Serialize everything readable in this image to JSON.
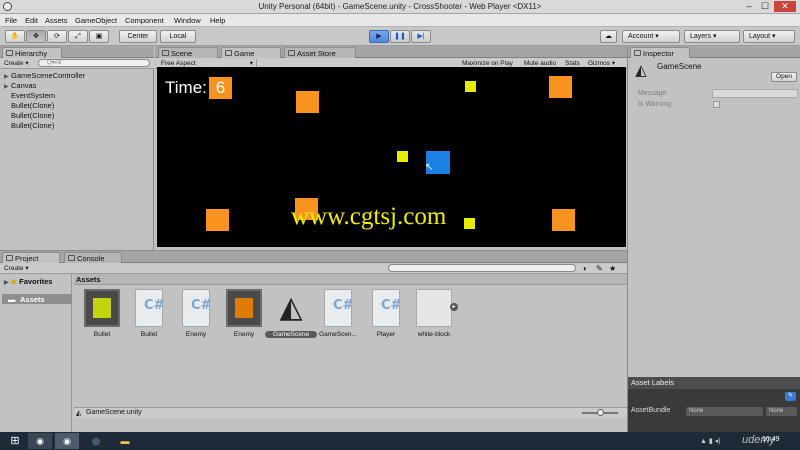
{
  "window": {
    "title": "Unity Personal (64bit) - GameScene.unity - CrossShooter - Web Player <DX11>",
    "min": "–",
    "max": "☐",
    "close": "✕"
  },
  "menu": [
    "File",
    "Edit",
    "Assets",
    "GameObject",
    "Component",
    "Window",
    "Help"
  ],
  "toolbar": {
    "tools": [
      "✋",
      "✥",
      "⟳",
      "⤢",
      "▣"
    ],
    "pivot": "Center",
    "space": "Local",
    "play": "▶",
    "pause": "❚❚",
    "step": "▶|",
    "account": "Account",
    "layers": "Layers",
    "layout": "Layout"
  },
  "hierarchy": {
    "tab": "Hierarchy",
    "create": "Create",
    "search_placeholder": "Q▾All",
    "items": [
      {
        "label": "GameSceneController",
        "arrow": "▶"
      },
      {
        "label": "Canvas",
        "arrow": "▶"
      },
      {
        "label": "EventSystem",
        "arrow": ""
      },
      {
        "label": "Bullet(Clone)",
        "arrow": ""
      },
      {
        "label": "Bullet(Clone)",
        "arrow": ""
      },
      {
        "label": "Bullet(Clone)",
        "arrow": ""
      }
    ]
  },
  "center_tabs": {
    "scene": "Scene",
    "game": "Game",
    "store": "Asset Store"
  },
  "game_bar": {
    "aspect": "Free Aspect",
    "maximize": "Maximize on Play",
    "mute": "Mute audio",
    "stats": "Stats",
    "gizmos": "Gizmos"
  },
  "game": {
    "time_label": "Time:",
    "time_value": "6",
    "watermark": "www.cgtsj.com",
    "colors": {
      "enemy": "#f7931e",
      "bullet": "#e5ec00",
      "player": "#1c7fe6",
      "background": "#000000"
    }
  },
  "inspector": {
    "tab": "Inspector",
    "object": "GameScene",
    "open": "Open",
    "message_label": "Message",
    "warning_label": "Is Warning",
    "asset_labels": "Asset Labels",
    "assetbundle_label": "AssetBundle",
    "none1": "None",
    "none2": "None"
  },
  "project": {
    "tab": "Project",
    "console_tab": "Console",
    "create": "Create",
    "favorites": "Favorites",
    "assets_tree": "Assets",
    "assets_header": "Assets",
    "footer": "GameScene.unity",
    "assets": [
      {
        "name": "Bullet",
        "kind": "prefab",
        "color": "#c3d40f"
      },
      {
        "name": "Bullet",
        "kind": "script"
      },
      {
        "name": "Enemy",
        "kind": "script"
      },
      {
        "name": "Enemy",
        "kind": "prefab",
        "color": "#e07b0a"
      },
      {
        "name": "GameScene",
        "kind": "scene"
      },
      {
        "name": "GameScen...",
        "kind": "script"
      },
      {
        "name": "Player",
        "kind": "script"
      },
      {
        "name": "white-block",
        "kind": "texture"
      }
    ]
  },
  "taskbar": {
    "clock": "10:49",
    "udemy": "udemy"
  }
}
